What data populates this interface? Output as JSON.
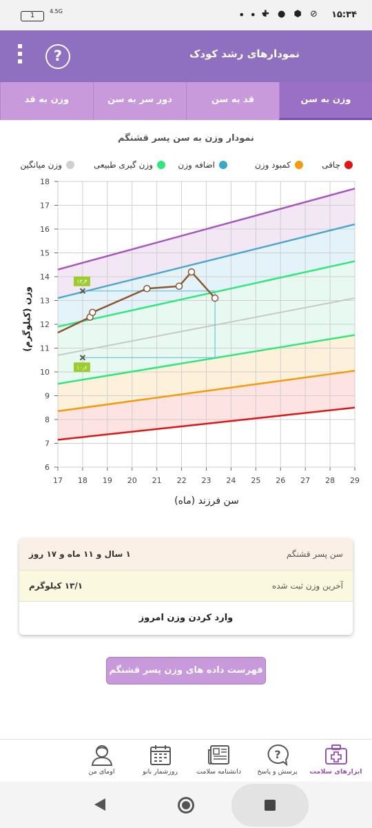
{
  "status_bar": {
    "time": "۱۵:۳۴",
    "battery": "1",
    "network": "4.5G"
  },
  "app_bar": {
    "title": "نمودارهای رشد کودک",
    "help_icon": "help-icon",
    "menu_icon": "more-vert-icon"
  },
  "tabs": [
    {
      "label": "وزن به سن",
      "active": true
    },
    {
      "label": "قد به سن",
      "active": false
    },
    {
      "label": "دور سر به سن",
      "active": false
    },
    {
      "label": "وزن به قد",
      "active": false
    }
  ],
  "chart_title": "نمودار وزن به سن پسر قشنگم",
  "legend": [
    {
      "label": "چاقی",
      "color": "#e01414"
    },
    {
      "label": "کمبود وزن",
      "color": "#f59a0a"
    },
    {
      "label": "اضافه وزن",
      "color": "#3aa9c8"
    },
    {
      "label": "وزن گیری طبیعی",
      "color": "#2ee87a"
    },
    {
      "label": "وزن میانگین",
      "color": "#d0d0d0"
    }
  ],
  "chart_data": {
    "type": "line",
    "xlabel": "سن فرزند (ماه)",
    "ylabel": "وزن (کیلوگرم)",
    "xlim": [
      17,
      29
    ],
    "ylim": [
      6,
      18
    ],
    "x_ticks": [
      "17",
      "18",
      "19",
      "20",
      "21",
      "22",
      "23",
      "24",
      "25",
      "26",
      "27",
      "28",
      "29"
    ],
    "y_ticks": [
      "6",
      "7",
      "8",
      "9",
      "10",
      "11",
      "12",
      "13",
      "14",
      "15",
      "16",
      "17",
      "18"
    ],
    "grid": true,
    "reference_lines": [
      {
        "name": "purple",
        "color": "#a855c0",
        "x": [
          17,
          29
        ],
        "y": [
          14.3,
          17.7
        ]
      },
      {
        "name": "blue",
        "color": "#4aa8cc",
        "x": [
          17,
          29
        ],
        "y": [
          13.1,
          16.2
        ]
      },
      {
        "name": "green-upper",
        "color": "#2ee87a",
        "x": [
          17,
          29
        ],
        "y": [
          11.9,
          14.65
        ]
      },
      {
        "name": "average",
        "color": "#c8c8c8",
        "x": [
          17,
          29
        ],
        "y": [
          10.7,
          13.1
        ]
      },
      {
        "name": "green-lower",
        "color": "#2ee87a",
        "x": [
          17,
          29
        ],
        "y": [
          9.5,
          11.55
        ]
      },
      {
        "name": "orange",
        "color": "#f59a0a",
        "x": [
          17,
          29
        ],
        "y": [
          8.35,
          10.05
        ]
      },
      {
        "name": "red",
        "color": "#e01414",
        "x": [
          17,
          29
        ],
        "y": [
          7.15,
          8.5
        ]
      }
    ],
    "series": [
      {
        "color": "#8a5530",
        "x": [
          17.0,
          18.3,
          18.4,
          20.6,
          21.9,
          22.4,
          23.35
        ],
        "y": [
          11.65,
          12.3,
          12.5,
          13.5,
          13.6,
          14.2,
          13.1
        ]
      }
    ],
    "markers": [
      {
        "x": 18.0,
        "y": 13.4,
        "label": "۱۳٫۴"
      },
      {
        "x": 18.0,
        "y": 10.6,
        "label": "۱۰٫۶"
      }
    ]
  },
  "info_card": {
    "age_label": "سن پسر قشنگم",
    "age_value": "۱ سال و ۱۱ ماه و ۱۷ روز",
    "last_weight_label": "آخرین وزن ثبت شده",
    "last_weight_value": "۱۳/۱ کیلوگرم",
    "enter_weight_button": "وارد کردن وزن امروز"
  },
  "data_list_button": "فهرست داده های وزن پسر قشنگم",
  "bottom_nav": [
    {
      "label": "ابزارهای سلامت",
      "icon": "medical-kit-icon",
      "active": true
    },
    {
      "label": "پرسش و پاسخ",
      "icon": "question-bubble-icon",
      "active": false
    },
    {
      "label": "دانشنامه سلامت",
      "icon": "newspaper-icon",
      "active": false
    },
    {
      "label": "روزشمار بانو",
      "icon": "calendar-icon",
      "active": false
    },
    {
      "label": "اومای من",
      "icon": "user-icon",
      "active": false
    }
  ]
}
